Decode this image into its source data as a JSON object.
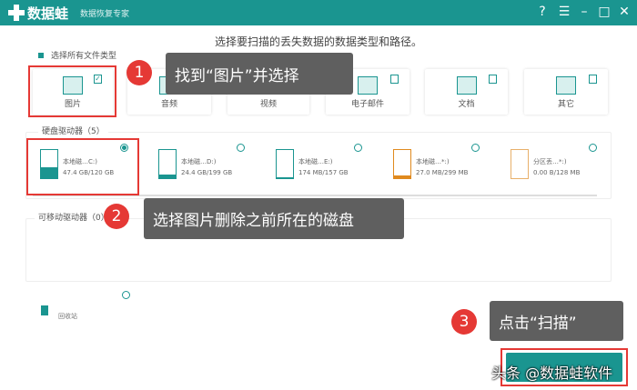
{
  "app": {
    "name": "数据蛙",
    "subtitle": "数据恢复专家"
  },
  "titlebar_icons": [
    "help-icon",
    "menu-icon",
    "minimize-icon",
    "maximize-icon",
    "close-icon"
  ],
  "heading": "选择要扫描的丢失数据的数据类型和路径。",
  "select_all": "选择所有文件类型",
  "file_types": [
    {
      "label": "图片",
      "checked": true
    },
    {
      "label": "音频",
      "checked": false
    },
    {
      "label": "视频",
      "checked": false
    },
    {
      "label": "电子邮件",
      "checked": false
    },
    {
      "label": "文档",
      "checked": false
    },
    {
      "label": "其它",
      "checked": false
    }
  ],
  "hard_drives": {
    "label": "硬盘驱动器（5）",
    "items": [
      {
        "name": "本地磁…C:)",
        "size": "47.4 GB/120 GB",
        "used": 0.4,
        "color": "#1a9590",
        "selected": true
      },
      {
        "name": "本地磁…D:)",
        "size": "24.4 GB/199 GB",
        "used": 0.12,
        "color": "#1a9590",
        "selected": false
      },
      {
        "name": "本地磁…E:)",
        "size": "174 MB/157 GB",
        "used": 0.01,
        "color": "#1a9590",
        "selected": false
      },
      {
        "name": "本地磁…*:)",
        "size": "27.0 MB/299 MB",
        "used": 0.09,
        "color": "#e08a1e",
        "selected": false
      },
      {
        "name": "分区丢…*:)",
        "size": "0.00  B/128 MB",
        "used": 0,
        "color": "#e8b06a",
        "selected": false
      }
    ]
  },
  "removable": {
    "label": "可移动驱动器（0）"
  },
  "recycle_bin": "回收站",
  "callouts": [
    {
      "num": "1",
      "text": "找到“图片”并选择"
    },
    {
      "num": "2",
      "text": "选择图片删除之前所在的磁盘"
    },
    {
      "num": "3",
      "text": "点击“扫描”"
    }
  ],
  "watermark": "头条 @数据蛙软件"
}
